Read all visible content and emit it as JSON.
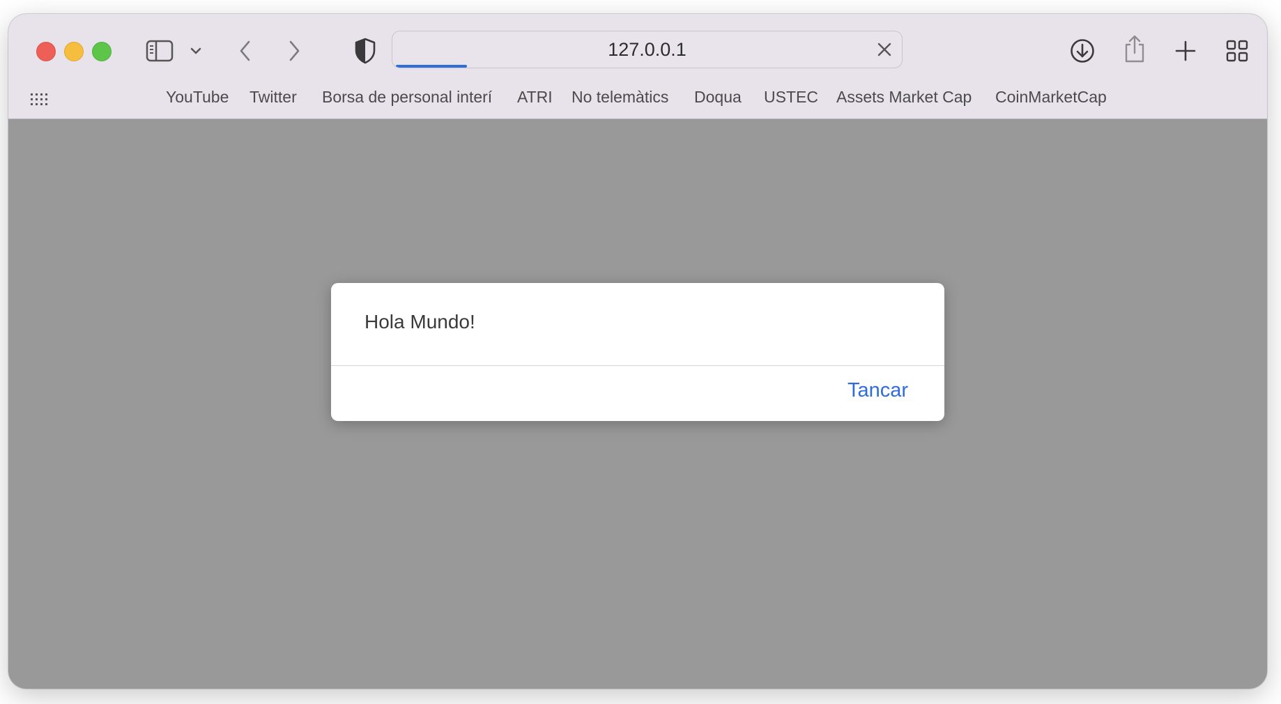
{
  "address_bar": {
    "url": "127.0.0.1",
    "load_progress": 0.14
  },
  "toolbar_icons": [
    "sidebar-icon",
    "chevron-down-icon",
    "back-icon",
    "forward-icon",
    "privacy-shield-icon",
    "close-icon",
    "download-icon",
    "share-icon",
    "new-tab-plus-icon",
    "tab-overview-icon",
    "grid-dots-icon"
  ],
  "bookmarks": [
    "YouTube",
    "Twitter",
    "Borsa de personal interí",
    "ATRI",
    "No telemàtics",
    "Doqua",
    "USTEC",
    "Assets Market Cap",
    "CoinMarketCap"
  ],
  "dialog": {
    "message": "Hola Mundo!",
    "button_label": "Tancar"
  },
  "colors": {
    "accent": "#2f6ed8",
    "toolbar_bg": "#e8e3ea",
    "page_overlay": "#999999",
    "close": "#ed5f57",
    "minimize": "#f5be3e",
    "maximize": "#5dc64a"
  }
}
